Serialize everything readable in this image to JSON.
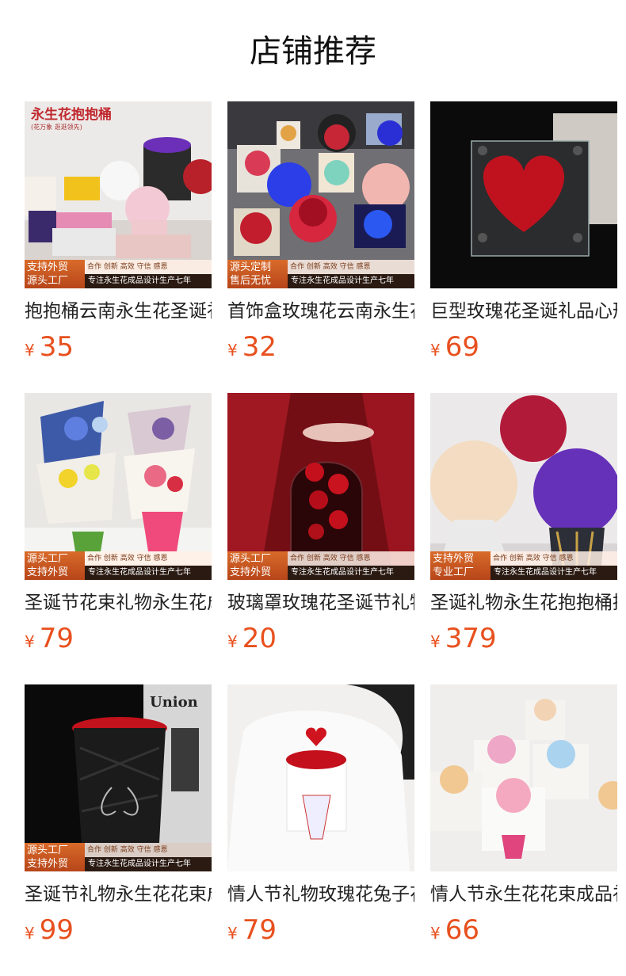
{
  "page": {
    "title": "店铺推荐"
  },
  "products": [
    {
      "name": "抱抱桶云南永生花圣诞礼物",
      "currency": "¥",
      "price": "35",
      "overlay": {
        "brand": "永生花抱抱桶",
        "brand_sub": "(花万象 逛逛领先)"
      },
      "promo": {
        "left": [
          "支持外贸",
          "源头工厂"
        ],
        "top": "合作 创新 高效 守信 感恩",
        "bottom": "专注永生花成品设计生产七年"
      }
    },
    {
      "name": "首饰盒玫瑰花云南永生花礼盒",
      "currency": "¥",
      "price": "32",
      "promo": {
        "left": [
          "源头定制",
          "售后无忧"
        ],
        "top": "合作 创新 高效 守信 感恩",
        "bottom": "专注永生花成品设计生产七年"
      }
    },
    {
      "name": "巨型玫瑰花圣诞礼品心形摆件",
      "currency": "¥",
      "price": "69"
    },
    {
      "name": "圣诞节花束礼物永生花成品",
      "currency": "¥",
      "price": "79",
      "promo": {
        "left": [
          "源头工厂",
          "支持外贸"
        ],
        "top": "合作 创新 高效 守信 感恩",
        "bottom": "专注永生花成品设计生产七年"
      }
    },
    {
      "name": "玻璃罩玫瑰花圣诞节礼物",
      "currency": "¥",
      "price": "20",
      "promo": {
        "left": [
          "源头工厂",
          "支持外贸"
        ],
        "top": "合作 创新 高效 守信 感恩",
        "bottom": "专注永生花成品设计生产七年"
      }
    },
    {
      "name": "圣诞礼物永生花抱抱桶摆件",
      "currency": "¥",
      "price": "379",
      "promo": {
        "left": [
          "支持外贸",
          "专业工厂"
        ],
        "top": "合作 创新 高效 守信 感恩",
        "bottom": "专注永生花成品设计生产七年"
      }
    },
    {
      "name": "圣诞节礼物永生花花束成品",
      "currency": "¥",
      "price": "99",
      "overlay": {
        "union": "Union"
      },
      "promo": {
        "left": [
          "源头工厂",
          "支持外贸"
        ],
        "top": "合作 创新 高效 守信 感恩",
        "bottom": "专注永生花成品设计生产七年"
      }
    },
    {
      "name": "情人节礼物玫瑰花兔子花束",
      "currency": "¥",
      "price": "79"
    },
    {
      "name": "情人节永生花花束成品礼物",
      "currency": "¥",
      "price": "66"
    }
  ]
}
